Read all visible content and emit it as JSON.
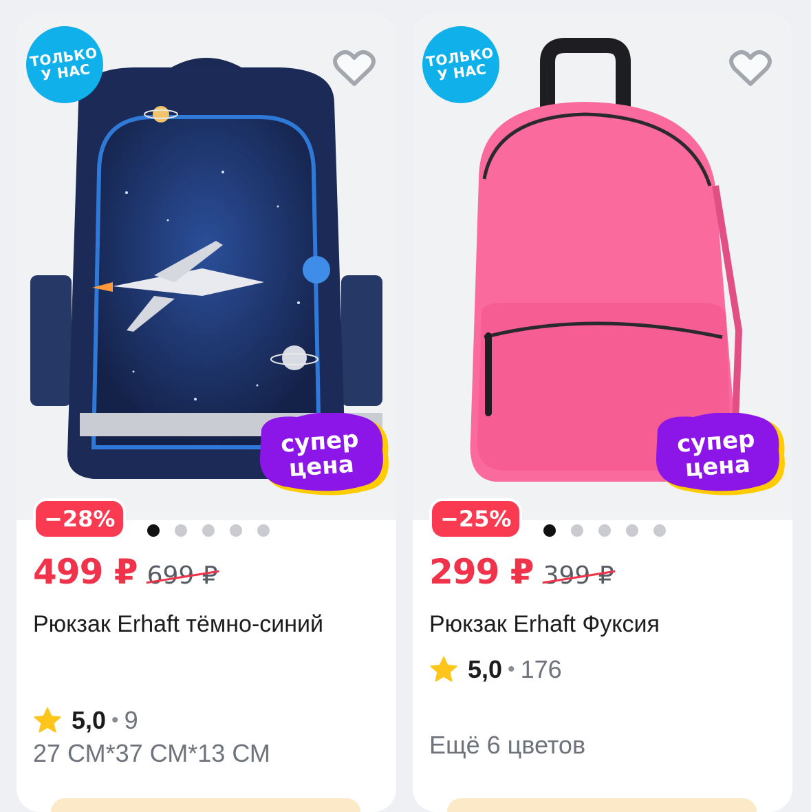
{
  "products": [
    {
      "only_badge": "ТОЛЬКО\nУ НАС",
      "super_badge": "супер\nцена",
      "discount": "−28%",
      "price": "499 ₽",
      "old_price": "699 ₽",
      "title": "Рюкзак Erhaft тёмно-синий",
      "rating": "5,0",
      "separator": "•",
      "reviews": "9",
      "extra": "27 СМ*37 СМ*13 СМ",
      "image_dots": 5,
      "active_dot": 0,
      "bag_color": "navy-space"
    },
    {
      "only_badge": "ТОЛЬКО\nУ НАС",
      "super_badge": "супер\nцена",
      "discount": "−25%",
      "price": "299 ₽",
      "old_price": "399 ₽",
      "title": "Рюкзак Erhaft Фуксия",
      "rating": "5,0",
      "separator": "•",
      "reviews": "176",
      "extra": "Ещё 6 цветов",
      "image_dots": 5,
      "active_dot": 0,
      "bag_color": "fuchsia"
    }
  ],
  "colors": {
    "price": "#f0334a",
    "discount_bg": "#f93a50",
    "only_badge_bg": "#10b1ea",
    "super_badge_bg": "#8c16e8",
    "super_badge_accent": "#ffcc00",
    "star": "#ffc51a",
    "bag_fuchsia": "#fb6a9c",
    "bag_navy": "#1b2a57"
  },
  "icons": {
    "favorite": "heart-outline-icon",
    "rating": "star-icon"
  }
}
